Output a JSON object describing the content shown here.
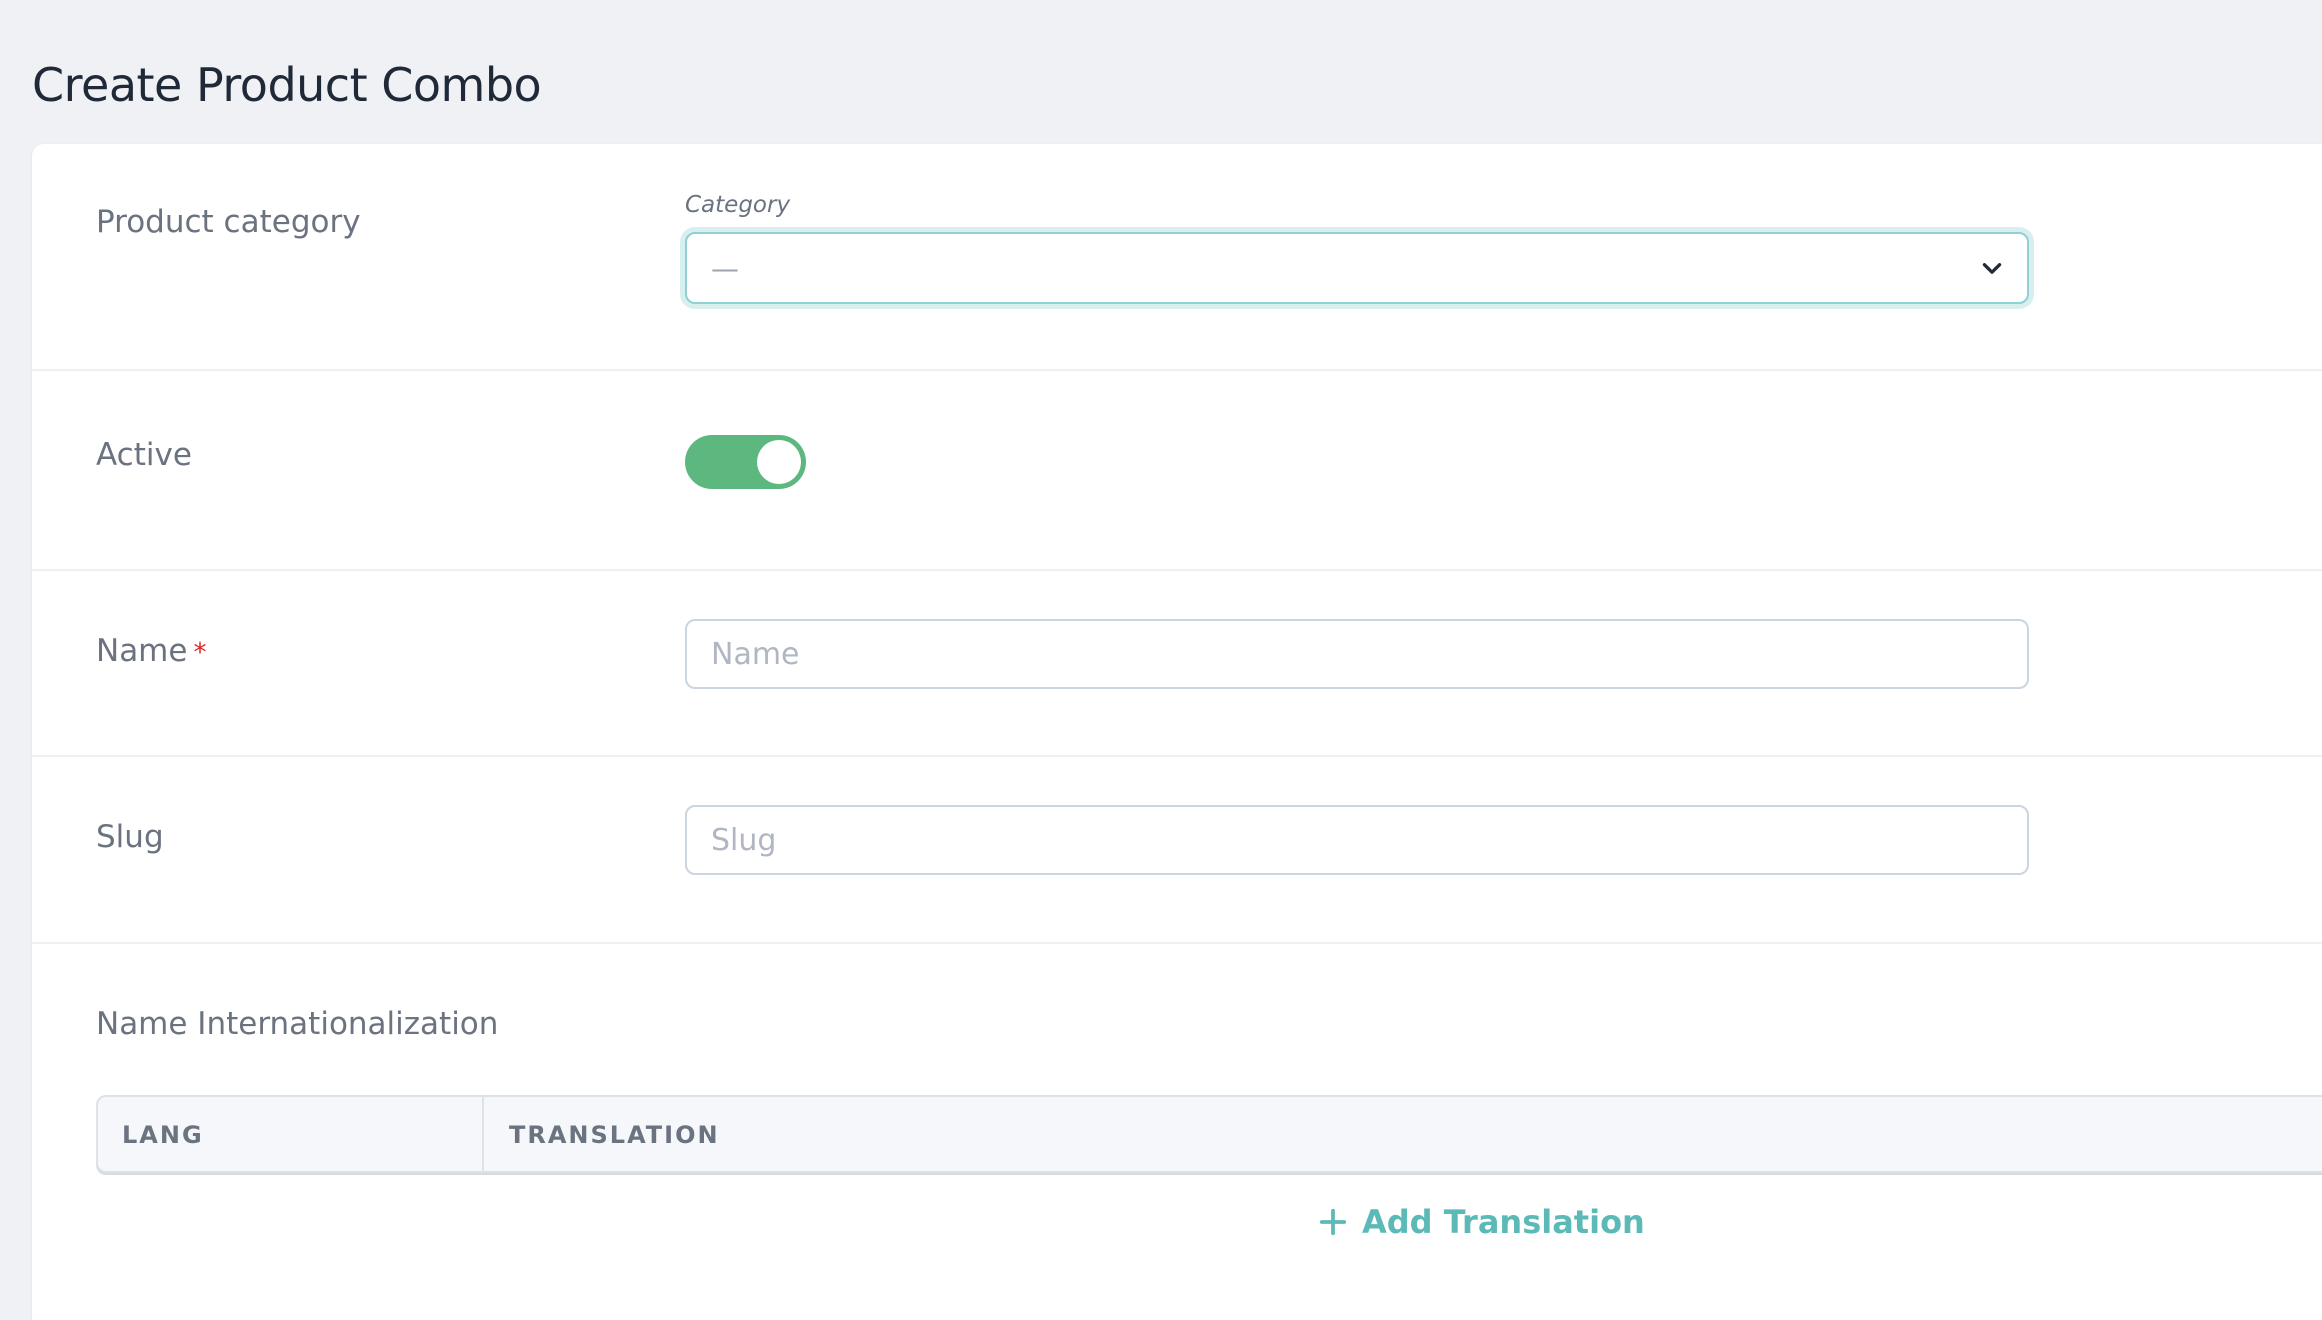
{
  "page": {
    "title": "Create Product Combo"
  },
  "form": {
    "category": {
      "label": "Product category",
      "caption": "Category",
      "selected_value": "—",
      "chevron_icon": "chevron-down-icon"
    },
    "active": {
      "label": "Active",
      "enabled": true,
      "on_color": "#5cb87e"
    },
    "name": {
      "label": "Name",
      "required_mark": "*",
      "value": "",
      "placeholder": "Name"
    },
    "slug": {
      "label": "Slug",
      "value": "",
      "placeholder": "Slug"
    },
    "name_i18n": {
      "label": "Name Internationalization",
      "columns": [
        "LANG",
        "TRANSLATION"
      ],
      "rows": [],
      "add_label": "Add Translation",
      "add_icon": "plus-icon",
      "accent_color": "#5bbab7"
    }
  }
}
